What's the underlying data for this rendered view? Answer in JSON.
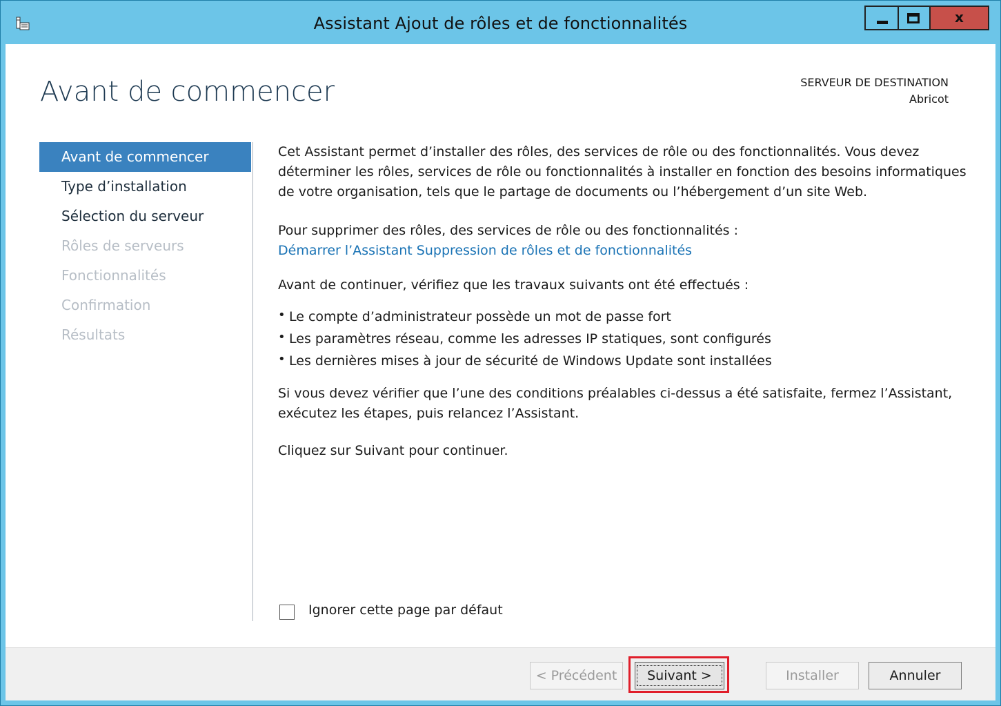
{
  "window": {
    "title": "Assistant Ajout de rôles et de fonctionnalités",
    "controls": {
      "close_glyph": "x"
    },
    "icon": "server-manager-icon"
  },
  "header": {
    "page_title": "Avant de commencer",
    "destination_label": "SERVEUR DE DESTINATION",
    "destination_server": "Abricot"
  },
  "nav": {
    "items": [
      {
        "label": "Avant de commencer",
        "state": "active"
      },
      {
        "label": "Type d’installation",
        "state": "enabled"
      },
      {
        "label": "Sélection du serveur",
        "state": "enabled"
      },
      {
        "label": "Rôles de serveurs",
        "state": "disabled"
      },
      {
        "label": "Fonctionnalités",
        "state": "disabled"
      },
      {
        "label": "Confirmation",
        "state": "disabled"
      },
      {
        "label": "Résultats",
        "state": "disabled"
      }
    ]
  },
  "content": {
    "intro": "Cet Assistant permet d’installer des rôles, des services de rôle ou des fonctionnalités. Vous devez déterminer les rôles, services de rôle ou fonctionnalités à installer en fonction des besoins informatiques de votre organisation, tels que le partage de documents ou l’hébergement d’un site Web.",
    "remove_text": "Pour supprimer des rôles, des services de rôle ou des fonctionnalités :",
    "remove_link": "Démarrer l’Assistant Suppression de rôles et de fonctionnalités",
    "checklist_intro": "Avant de continuer, vérifiez que les travaux suivants ont été effectués :",
    "checklist": [
      "Le compte d’administrateur possède un mot de passe fort",
      "Les paramètres réseau, comme les adresses IP statiques, sont configurés",
      "Les dernières mises à jour de sécurité de Windows Update sont installées"
    ],
    "prereq_note": "Si vous devez vérifier que l’une des conditions préalables ci-dessus a été satisfaite, fermez l’Assistant, exécutez les étapes, puis relancez l’Assistant.",
    "continue_note": "Cliquez sur Suivant pour continuer.",
    "skip_checkbox_label": "Ignorer cette page par défaut",
    "skip_checked": false
  },
  "footer": {
    "prev_label": "< Précédent",
    "next_label": "Suivant >",
    "install_label": "Installer",
    "cancel_label": "Annuler"
  },
  "colors": {
    "titlebar": "#6cc5e8",
    "close_button": "#c7504a",
    "nav_active": "#3a82bf",
    "link": "#1a73b5",
    "highlight_frame": "#e01e2a"
  }
}
